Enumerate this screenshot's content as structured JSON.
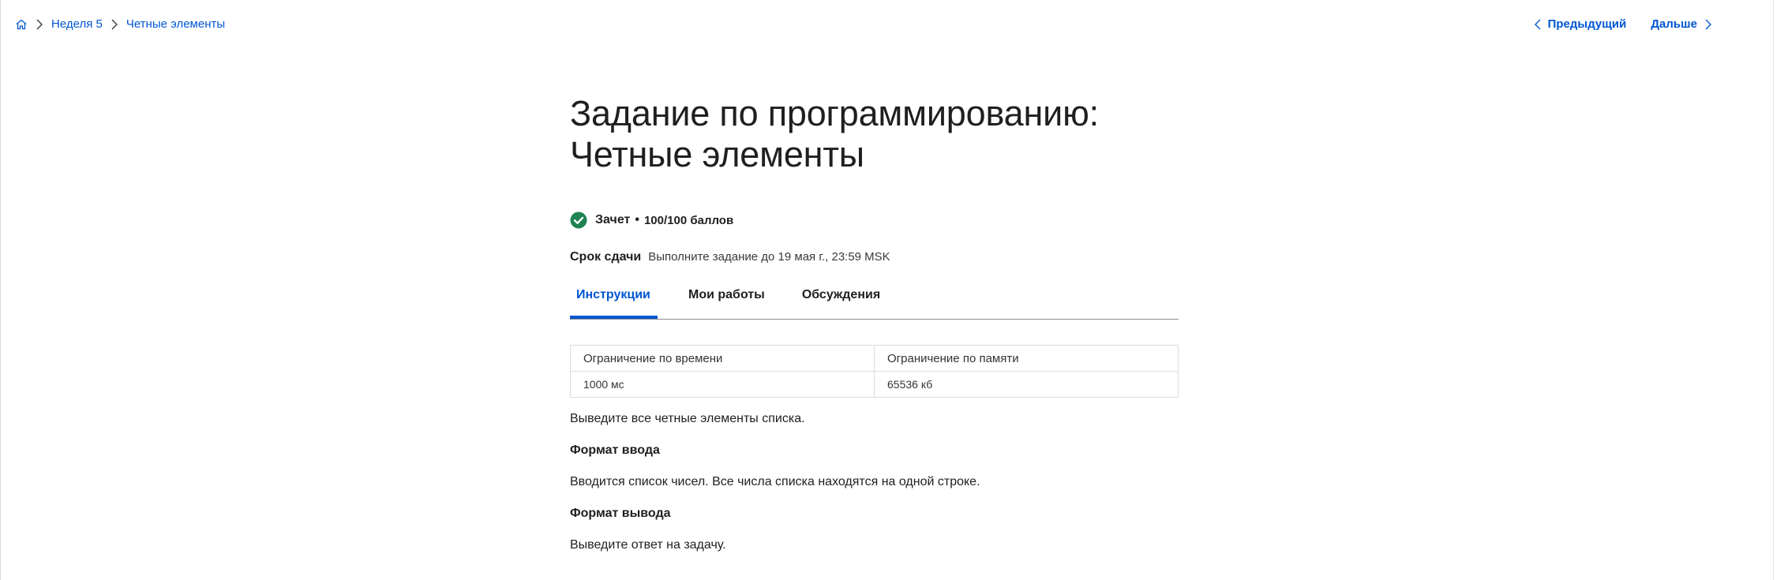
{
  "breadcrumb": {
    "home_icon": "home-icon",
    "items": [
      "Неделя 5",
      "Четные элементы"
    ]
  },
  "nav": {
    "prev_label": "Предыдущий",
    "next_label": "Дальше"
  },
  "title": "Задание по программированию: Четные элементы",
  "status": {
    "pass_label": "Зачет",
    "separator": "•",
    "score": "100/100 баллов"
  },
  "deadline": {
    "label": "Срок сдачи",
    "value": "Выполните задание до 19 мая г., 23:59 MSK"
  },
  "tabs": [
    {
      "label": "Инструкции",
      "active": true
    },
    {
      "label": "Мои работы",
      "active": false
    },
    {
      "label": "Обсуждения",
      "active": false
    }
  ],
  "limits": {
    "headers": [
      "Ограничение по времени",
      "Ограничение по памяти"
    ],
    "values": [
      "1000 мс",
      "65536 кб"
    ]
  },
  "content": {
    "description": "Выведите все четные элементы списка.",
    "input_heading": "Формат ввода",
    "input_text": "Вводится список чисел. Все числа списка находятся на одной строке.",
    "output_heading": "Формат вывода",
    "output_text": "Выведите ответ на задачу."
  },
  "colors": {
    "accent": "#0056d2",
    "success": "#1f8354"
  }
}
